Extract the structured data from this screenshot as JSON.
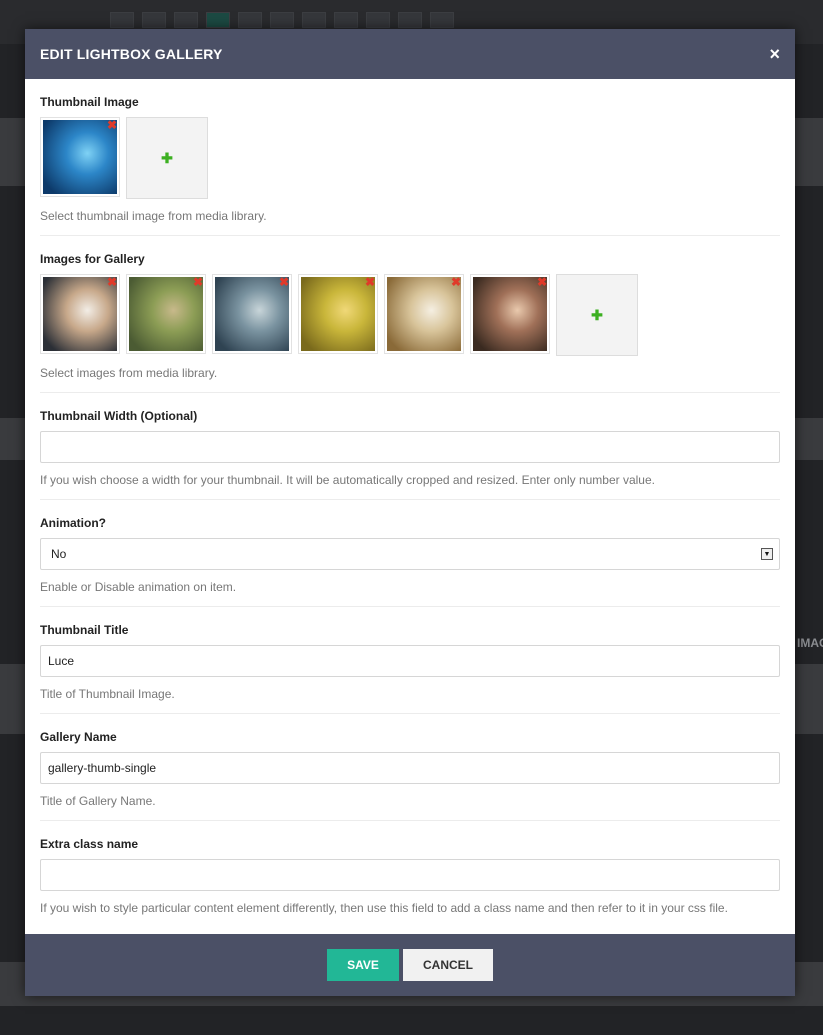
{
  "background": {
    "side_label": "IMAG"
  },
  "modal": {
    "title": "EDIT LIGHTBOX GALLERY",
    "close_glyph": "×"
  },
  "thumbnail_image": {
    "label": "Thumbnail Image",
    "help": "Select thumbnail image from media library.",
    "images": [
      {
        "icon": "fantasy-hero-thumbnail",
        "colors": [
          "#0d3a6a",
          "#2c86c8",
          "#7fd2f5"
        ]
      }
    ],
    "remove_glyph": "✖",
    "add_glyph": "✚"
  },
  "gallery_images": {
    "label": "Images for Gallery",
    "help": "Select images from media library.",
    "images": [
      {
        "icon": "two-men-suits-image",
        "colors": [
          "#2b2f36",
          "#c7a88a",
          "#f2ede6"
        ]
      },
      {
        "icon": "mermaid-image",
        "colors": [
          "#4b5b33",
          "#8c9d55",
          "#c8b98b"
        ]
      },
      {
        "icon": "warriors-image",
        "colors": [
          "#2f4352",
          "#7a93a0",
          "#c8d5d9"
        ]
      },
      {
        "icon": "frog-creatures-image",
        "colors": [
          "#7a6a1c",
          "#c9b63a",
          "#f0d878"
        ]
      },
      {
        "icon": "hen-in-nest-image",
        "colors": [
          "#8a6a38",
          "#d8c49a",
          "#f5efe2"
        ]
      },
      {
        "icon": "couple-image",
        "colors": [
          "#3a2a20",
          "#a07058",
          "#e9c9ad"
        ]
      }
    ],
    "remove_glyph": "✖",
    "add_glyph": "✚"
  },
  "thumbnail_width": {
    "label": "Thumbnail Width (Optional)",
    "value": "",
    "help": "If you wish choose a width for your thumbnail. It will be automatically cropped and resized. Enter only number value."
  },
  "animation": {
    "label": "Animation?",
    "selected": "No",
    "arrow": "▼",
    "help": "Enable or Disable animation on item."
  },
  "thumbnail_title": {
    "label": "Thumbnail Title",
    "value": "Luce",
    "help": "Title of Thumbnail Image."
  },
  "gallery_name": {
    "label": "Gallery Name",
    "value": "gallery-thumb-single",
    "help": "Title of Gallery Name."
  },
  "extra_class": {
    "label": "Extra class name",
    "value": "",
    "help": "If you wish to style particular content element differently, then use this field to add a class name and then refer to it in your css file."
  },
  "footer": {
    "save_label": "SAVE",
    "cancel_label": "CANCEL"
  },
  "colors": {
    "header_bg": "#4b5066",
    "save_bg": "#22b796",
    "remove_icon": "#e03a2a",
    "add_icon": "#3cb021"
  }
}
